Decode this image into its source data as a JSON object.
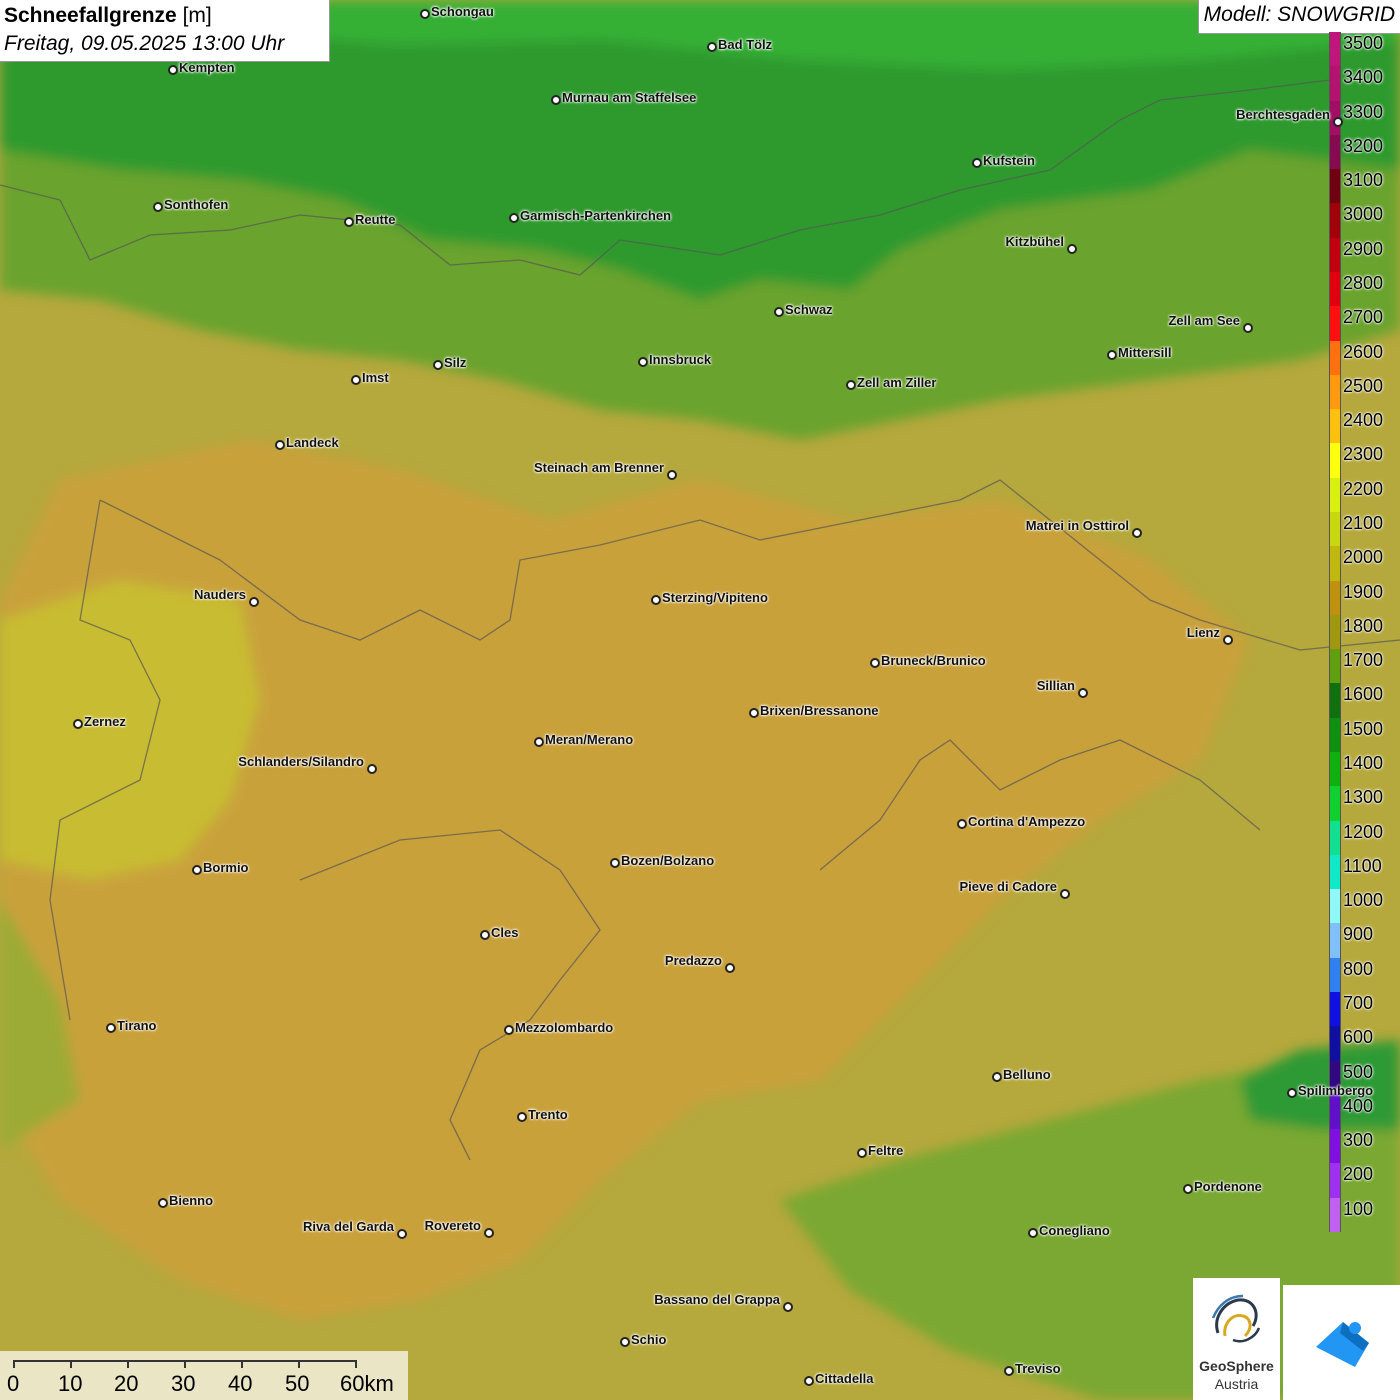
{
  "title": {
    "bold": "Schneefallgrenze",
    "unit": "[m]",
    "datetime": "Freitag, 09.05.2025 13:00 Uhr"
  },
  "model_label": "Modell: SNOWGRID",
  "legend": [
    {
      "label": "3500",
      "color": "#c0157a"
    },
    {
      "label": "3400",
      "color": "#b3126f"
    },
    {
      "label": "3300",
      "color": "#a00f63"
    },
    {
      "label": "3200",
      "color": "#850a50"
    },
    {
      "label": "3100",
      "color": "#700010"
    },
    {
      "label": "3000",
      "color": "#a0000a"
    },
    {
      "label": "2900",
      "color": "#c00010"
    },
    {
      "label": "2800",
      "color": "#e00010"
    },
    {
      "label": "2700",
      "color": "#ff1010"
    },
    {
      "label": "2600",
      "color": "#ff7010"
    },
    {
      "label": "2500",
      "color": "#ff9a10"
    },
    {
      "label": "2400",
      "color": "#ffc010"
    },
    {
      "label": "2300",
      "color": "#ffff10"
    },
    {
      "label": "2200",
      "color": "#d8f010"
    },
    {
      "label": "2100",
      "color": "#c8d810"
    },
    {
      "label": "2000",
      "color": "#c0b810"
    },
    {
      "label": "1900",
      "color": "#c09010"
    },
    {
      "label": "1800",
      "color": "#a09810"
    },
    {
      "label": "1700",
      "color": "#60a010"
    },
    {
      "label": "1600",
      "color": "#107010"
    },
    {
      "label": "1500",
      "color": "#109010"
    },
    {
      "label": "1400",
      "color": "#10b010"
    },
    {
      "label": "1300",
      "color": "#10d030"
    },
    {
      "label": "1200",
      "color": "#10e090"
    },
    {
      "label": "1100",
      "color": "#10e8c8"
    },
    {
      "label": "1000",
      "color": "#90f8f8"
    },
    {
      "label": "900",
      "color": "#80c0f8"
    },
    {
      "label": "800",
      "color": "#3080f0"
    },
    {
      "label": "700",
      "color": "#1010e0"
    },
    {
      "label": "600",
      "color": "#1010a0"
    },
    {
      "label": "500",
      "color": "#300880"
    },
    {
      "label": "400",
      "color": "#6010c8"
    },
    {
      "label": "300",
      "color": "#8010e0"
    },
    {
      "label": "200",
      "color": "#a030f0"
    },
    {
      "label": "100",
      "color": "#c060f0"
    }
  ],
  "cities": [
    {
      "name": "Schongau"
    },
    {
      "name": "Kempten"
    },
    {
      "name": "Bad Tölz"
    },
    {
      "name": "Murnau am Staffelsee"
    },
    {
      "name": "Berchtesgaden"
    },
    {
      "name": "Kufstein"
    },
    {
      "name": "Sonthofen"
    },
    {
      "name": "Reutte"
    },
    {
      "name": "Garmisch-Partenkirchen"
    },
    {
      "name": "Kitzbühel"
    },
    {
      "name": "Schwaz"
    },
    {
      "name": "Zell am See"
    },
    {
      "name": "Innsbruck"
    },
    {
      "name": "Mittersill"
    },
    {
      "name": "Silz"
    },
    {
      "name": "Imst"
    },
    {
      "name": "Zell am Ziller"
    },
    {
      "name": "Landeck"
    },
    {
      "name": "Steinach am Brenner"
    },
    {
      "name": "Matrei in Osttirol"
    },
    {
      "name": "Nauders"
    },
    {
      "name": "Sterzing/Vipiteno"
    },
    {
      "name": "Lienz"
    },
    {
      "name": "Bruneck/Brunico"
    },
    {
      "name": "Sillian"
    },
    {
      "name": "Zernez"
    },
    {
      "name": "Brixen/Bressanone"
    },
    {
      "name": "Meran/Merano"
    },
    {
      "name": "Schlanders/Silandro"
    },
    {
      "name": "Cortina d'Ampezzo"
    },
    {
      "name": "Bozen/Bolzano"
    },
    {
      "name": "Bormio"
    },
    {
      "name": "Pieve di Cadore"
    },
    {
      "name": "Cles"
    },
    {
      "name": "Predazzo"
    },
    {
      "name": "Tirano"
    },
    {
      "name": "Mezzolombardo"
    },
    {
      "name": "Belluno"
    },
    {
      "name": "Spilimbergo"
    },
    {
      "name": "Trento"
    },
    {
      "name": "Feltre"
    },
    {
      "name": "Pordenone"
    },
    {
      "name": "Bienno"
    },
    {
      "name": "Riva del Garda"
    },
    {
      "name": "Rovereto"
    },
    {
      "name": "Conegliano"
    },
    {
      "name": "Bassano del Grappa"
    },
    {
      "name": "Schio"
    },
    {
      "name": "Treviso"
    },
    {
      "name": "Cittadella"
    }
  ],
  "scale": {
    "labels": [
      "0",
      "10",
      "20",
      "30",
      "40",
      "50",
      "60km"
    ]
  },
  "logos": {
    "geosphere_name": "GeoSphere",
    "geosphere_sub": "Austria"
  }
}
